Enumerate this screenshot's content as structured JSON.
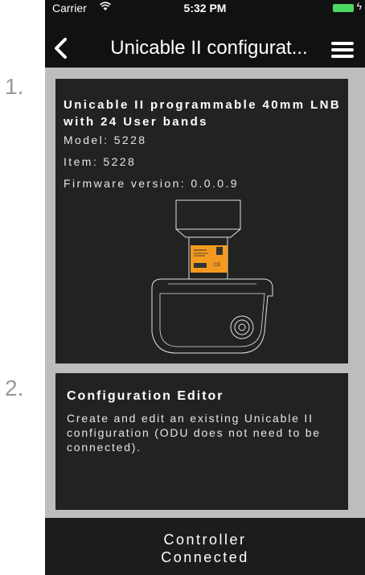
{
  "status_bar": {
    "carrier": "Carrier",
    "time": "5:32 PM",
    "battery_color": "#4cd964"
  },
  "nav": {
    "back_icon": "chevron-left-icon",
    "title": "Unicable II configurat...",
    "menu_icon": "hamburger-menu-icon"
  },
  "steps": [
    {
      "number": "1.",
      "title": "Unicable II programmable 40mm LNB with 24 User bands",
      "model": "Model: 5228",
      "item": "Item: 5228",
      "firmware": "Firmware version: 0.0.0.9",
      "image": "lnb-device-illustration"
    },
    {
      "number": "2.",
      "title": "Configuration Editor",
      "description": "Create and edit an existing Unicable II configuration (ODU does not need to be connected)."
    }
  ],
  "footer": {
    "line1": "Controller",
    "line2": "Connected"
  },
  "colors": {
    "background": "#111111",
    "content_bg": "#bdbdbd",
    "card_bg": "#222222",
    "label_orange": "#f39a1f"
  }
}
